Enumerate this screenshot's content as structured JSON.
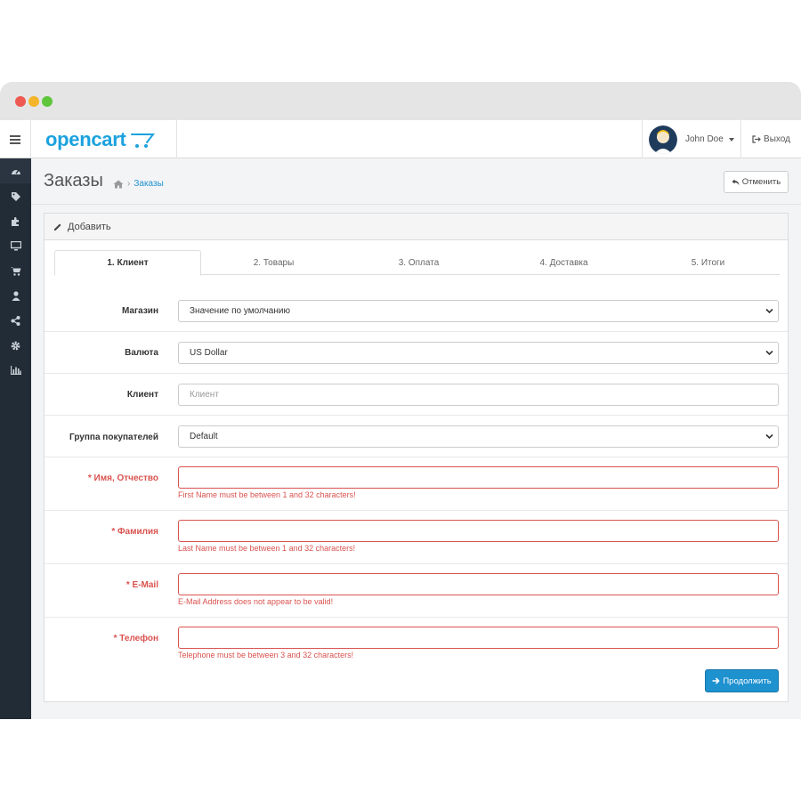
{
  "app": {
    "logo_text": "opencart"
  },
  "colors": {
    "accent": "#1e91cf",
    "error": "#d9534f",
    "sidebar": "#222c36",
    "logo": "#1ba2de"
  },
  "user": {
    "name": "John Doe",
    "logout_label": "Выход"
  },
  "sidebar": {
    "items": [
      {
        "icon": "dashboard-icon"
      },
      {
        "icon": "tags-icon"
      },
      {
        "icon": "puzzle-icon"
      },
      {
        "icon": "monitor-icon"
      },
      {
        "icon": "cart-icon"
      },
      {
        "icon": "user-icon"
      },
      {
        "icon": "share-icon"
      },
      {
        "icon": "gear-icon"
      },
      {
        "icon": "bar-chart-icon"
      }
    ]
  },
  "page": {
    "title": "Заказы",
    "breadcrumb": "Заказы",
    "cancel_label": "Отменить"
  },
  "panel": {
    "title": "Добавить",
    "tabs": [
      "1. Клиент",
      "2. Товары",
      "3. Оплата",
      "4. Доставка",
      "5. Итоги"
    ],
    "active_tab": 0
  },
  "form": {
    "store": {
      "label": "Магазин",
      "value": "Значение по умолчанию"
    },
    "currency": {
      "label": "Валюта",
      "value": "US Dollar"
    },
    "customer": {
      "label": "Клиент",
      "placeholder": "Клиент"
    },
    "customer_group": {
      "label": "Группа покупателей",
      "value": "Default"
    },
    "firstname": {
      "label": "* Имя, Отчество",
      "error": "First Name must be between 1 and 32 characters!"
    },
    "lastname": {
      "label": "* Фамилия",
      "error": "Last Name must be between 1 and 32 characters!"
    },
    "email": {
      "label": "* E-Mail",
      "error": "E-Mail Address does not appear to be valid!"
    },
    "telephone": {
      "label": "* Телефон",
      "error": "Telephone must be between 3 and 32 characters!"
    },
    "continue_label": "Продолжить"
  }
}
